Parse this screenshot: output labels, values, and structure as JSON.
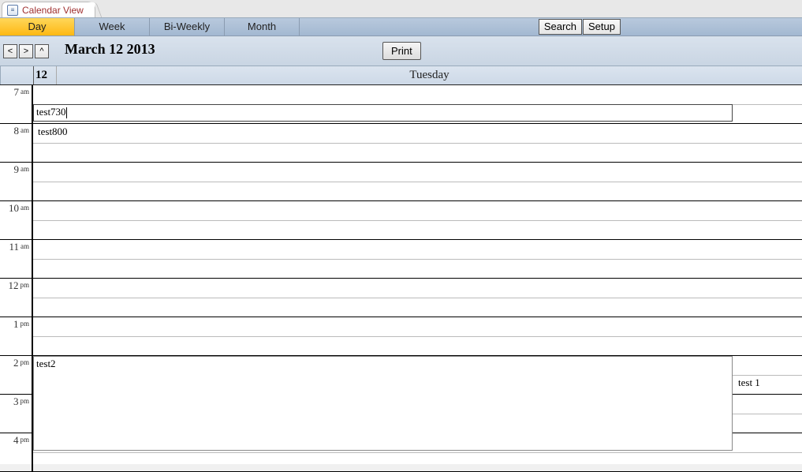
{
  "tab": {
    "title": "Calendar View"
  },
  "views": {
    "day": "Day",
    "week": "Week",
    "biweekly": "Bi-Weekly",
    "month": "Month"
  },
  "toolbar": {
    "search": "Search",
    "setup": "Setup",
    "print": "Print"
  },
  "nav": {
    "prev": "<",
    "next": ">",
    "up": "^"
  },
  "header": {
    "date_title": "March 12 2013",
    "day_number": "12",
    "day_name": "Tuesday"
  },
  "hours": [
    {
      "h": "7",
      "ap": "am"
    },
    {
      "h": "8",
      "ap": "am"
    },
    {
      "h": "9",
      "ap": "am"
    },
    {
      "h": "10",
      "ap": "am"
    },
    {
      "h": "11",
      "ap": "am"
    },
    {
      "h": "12",
      "ap": "pm"
    },
    {
      "h": "1",
      "ap": "pm"
    },
    {
      "h": "2",
      "ap": "pm"
    },
    {
      "h": "3",
      "ap": "pm"
    },
    {
      "h": "4",
      "ap": "pm"
    }
  ],
  "events": {
    "e730": "test730",
    "e800": "test800",
    "e2": "test2",
    "e1": "test 1"
  }
}
